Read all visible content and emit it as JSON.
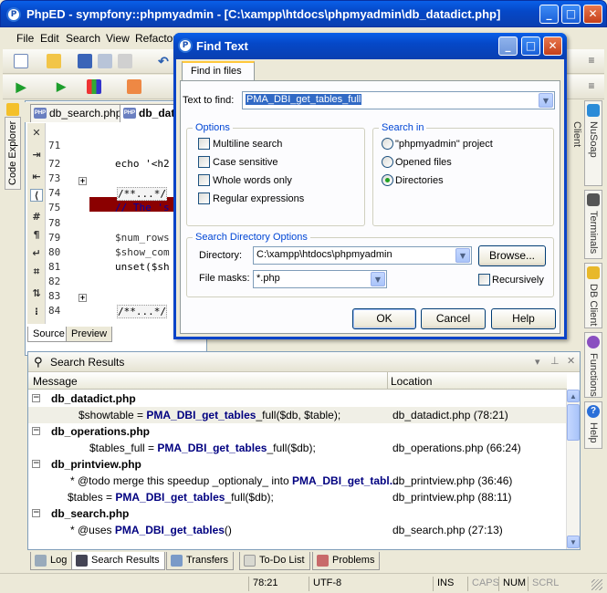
{
  "window": {
    "title": "PhpED - sympfony::phpmyadmin - [C:\\xampp\\htdocs\\phpmyadmin\\db_datadict.php]"
  },
  "menu": [
    {
      "label": "File",
      "u": "F"
    },
    {
      "label": "Edit",
      "u": "E"
    },
    {
      "label": "Search",
      "u": "S"
    },
    {
      "label": "View",
      "u": "V"
    },
    {
      "label": "Refactor",
      "u": ""
    }
  ],
  "left_panel": {
    "code_explorer": "Code Explorer"
  },
  "editor": {
    "tabs": [
      "db_search.php",
      "db_dat"
    ],
    "lines": [
      {
        "n": "71",
        "code": ""
      },
      {
        "n": "72",
        "code": "echo '<h2"
      },
      {
        "n": "73",
        "code": ""
      },
      {
        "n": "74",
        "code": "/**...*/"
      },
      {
        "n": "75",
        "code": "// The 's"
      },
      {
        "n": "78",
        "code": "$showtabl"
      },
      {
        "n": "79",
        "code": "$num_rows"
      },
      {
        "n": "80",
        "code": "$show_com"
      },
      {
        "n": "81",
        "code": "unset($sh"
      },
      {
        "n": "82",
        "code": ""
      },
      {
        "n": "83",
        "code": ""
      },
      {
        "n": "84",
        "code": "/**...*/"
      }
    ],
    "bottom_tabs": [
      "Source",
      "Preview"
    ]
  },
  "right_tabs": [
    "NuSoap Client",
    "Terminals",
    "DB Client",
    "Functions",
    "Help"
  ],
  "dialog": {
    "title": "Find Text",
    "tab": "Find in files",
    "text_to_find_label": "Text to find:",
    "text_to_find_value": "PMA_DBI_get_tables_full",
    "options_title": "Options",
    "options": [
      {
        "label": "Multiline search",
        "checked": false
      },
      {
        "label": "Case sensitive",
        "checked": false
      },
      {
        "label": "Whole words only",
        "checked": false
      },
      {
        "label": "Regular expressions",
        "checked": false
      }
    ],
    "search_in_title": "Search in",
    "search_in": [
      {
        "label": "\"phpmyadmin\" project",
        "selected": false
      },
      {
        "label": "Opened files",
        "selected": false
      },
      {
        "label": "Directories",
        "selected": true
      }
    ],
    "dir_options_title": "Search Directory Options",
    "directory_label": "Directory:",
    "directory_value": "C:\\xampp\\htdocs\\phpmyadmin",
    "browse_label": "Browse...",
    "file_masks_label": "File masks:",
    "file_masks_value": "*.php",
    "recursively_label": "Recursively",
    "recursively_checked": false,
    "ok": "OK",
    "cancel": "Cancel",
    "help": "Help"
  },
  "search_results": {
    "title": "Search Results",
    "col_message": "Message",
    "col_location": "Location",
    "rows": [
      {
        "type": "file",
        "msg": "db_datadict.php",
        "loc": ""
      },
      {
        "type": "hit",
        "pre": "$showtable    = ",
        "bold": "PMA_DBI_get_tables",
        "post": "_full($db, $table);",
        "loc": "db_datadict.php (78:21)"
      },
      {
        "type": "file",
        "msg": "db_operations.php",
        "loc": ""
      },
      {
        "type": "hit",
        "pre": "$tables_full = ",
        "bold": "PMA_DBI_get_tables",
        "post": "_full($db);",
        "loc": "db_operations.php (66:24)"
      },
      {
        "type": "file",
        "msg": "db_printview.php",
        "loc": ""
      },
      {
        "type": "hit",
        "pre": "* @todo merge this speedup _optionaly_ into ",
        "bold": "PMA_DBI_get_tabl...",
        "post": "",
        "loc": "db_printview.php (36:46)"
      },
      {
        "type": "hit",
        "pre": "$tables = ",
        "bold": "PMA_DBI_get_tables",
        "post": "_full($db);",
        "loc": "db_printview.php (88:11)"
      },
      {
        "type": "file",
        "msg": "db_search.php",
        "loc": ""
      },
      {
        "type": "hit",
        "pre": "* @uses    ",
        "bold": "PMA_DBI_get_tables",
        "post": "()",
        "loc": "db_search.php (27:13)"
      }
    ]
  },
  "bottom_tabs": [
    "Log",
    "Search Results",
    "Transfers",
    "To-Do List",
    "Problems"
  ],
  "status": {
    "position": "78:21",
    "encoding": "UTF-8",
    "ins": "INS",
    "caps": "CAPS",
    "num": "NUM",
    "scrl": "SCRL"
  },
  "colors": {
    "titlebar": "#0548c8",
    "highlight_line": "#8b0000",
    "selection": "#316ac5",
    "match_text": "#000080"
  }
}
